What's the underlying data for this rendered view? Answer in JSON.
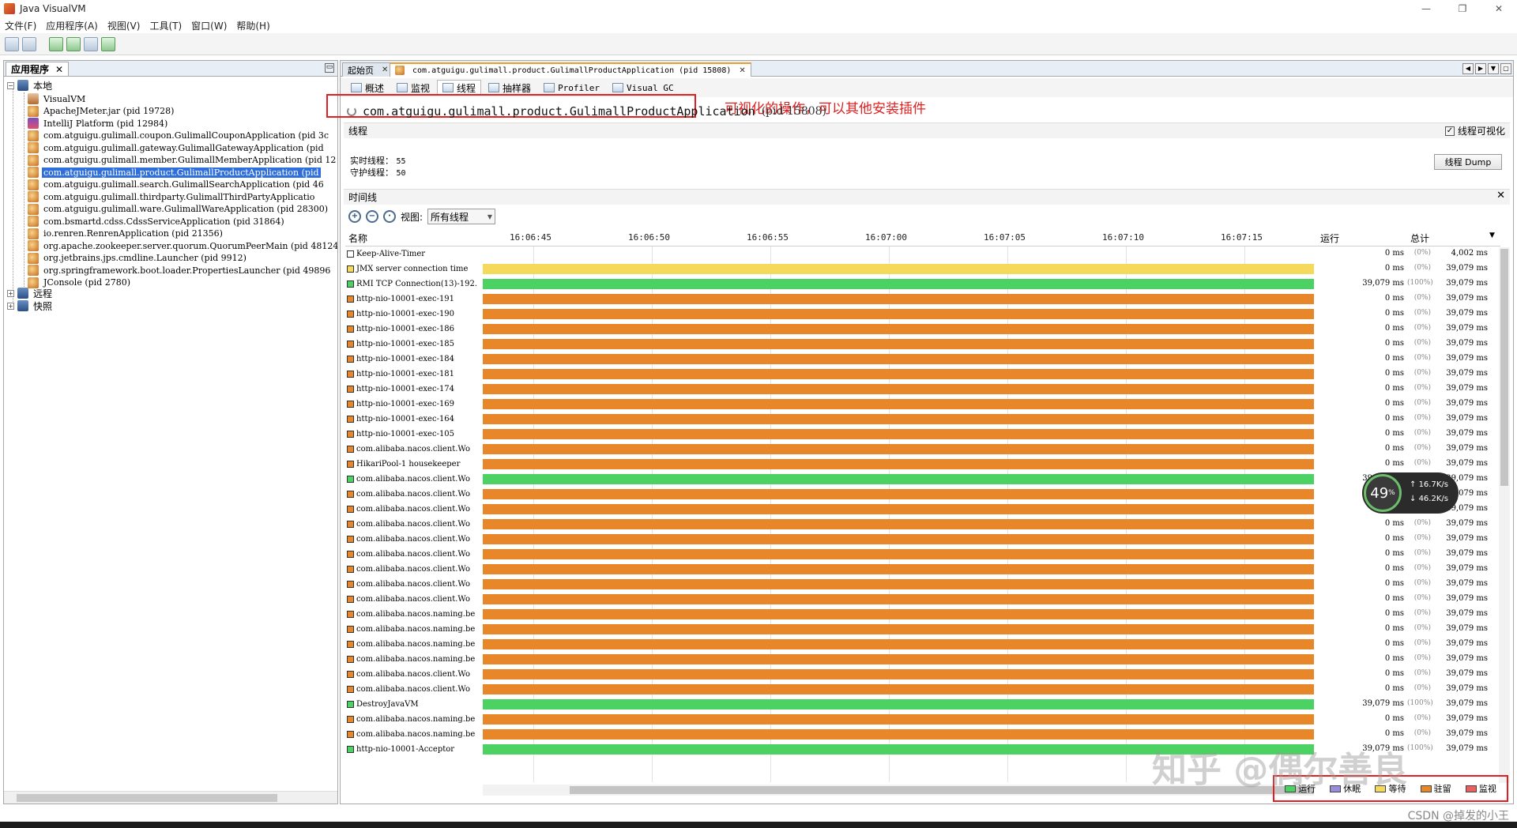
{
  "window": {
    "title": "Java VisualVM"
  },
  "menu": [
    "文件(F)",
    "应用程序(A)",
    "视图(V)",
    "工具(T)",
    "窗口(W)",
    "帮助(H)"
  ],
  "left_panel": {
    "tab": "应用程序",
    "tree": {
      "local": "本地",
      "items": [
        {
          "label": "VisualVM",
          "icon": "visualvm-icon"
        },
        {
          "label": "ApacheJMeter.jar (pid 19728)",
          "icon": "java-icon"
        },
        {
          "label": "IntelliJ Platform (pid 12984)",
          "icon": "intellij-icon"
        },
        {
          "label": "com.atguigu.gulimall.coupon.GulimallCouponApplication (pid 3c",
          "icon": "java-icon"
        },
        {
          "label": "com.atguigu.gulimall.gateway.GulimallGatewayApplication (pid",
          "icon": "java-icon"
        },
        {
          "label": "com.atguigu.gulimall.member.GulimallMemberApplication (pid 12",
          "icon": "java-icon"
        },
        {
          "label": "com.atguigu.gulimall.product.GulimallProductApplication (pid",
          "icon": "java-icon",
          "selected": true
        },
        {
          "label": "com.atguigu.gulimall.search.GulimallSearchApplication (pid 46",
          "icon": "java-icon"
        },
        {
          "label": "com.atguigu.gulimall.thirdparty.GulimallThirdPartyApplicatio",
          "icon": "java-icon"
        },
        {
          "label": "com.atguigu.gulimall.ware.GulimallWareApplication (pid 28300)",
          "icon": "java-icon"
        },
        {
          "label": "com.bsmartd.cdss.CdssServiceApplication (pid 31864)",
          "icon": "java-icon"
        },
        {
          "label": "io.renren.RenrenApplication (pid 21356)",
          "icon": "java-icon"
        },
        {
          "label": "org.apache.zookeeper.server.quorum.QuorumPeerMain (pid 48124)",
          "icon": "java-icon"
        },
        {
          "label": "org.jetbrains.jps.cmdline.Launcher (pid 9912)",
          "icon": "java-icon"
        },
        {
          "label": "org.springframework.boot.loader.PropertiesLauncher (pid 49896",
          "icon": "java-icon"
        },
        {
          "label": "JConsole (pid 2780)",
          "icon": "java-icon"
        }
      ],
      "remote": "远程",
      "snapshots": "快照"
    }
  },
  "doc_tabs": [
    {
      "label": "起始页"
    },
    {
      "label": "com.atguigu.gulimall.product.GulimallProductApplication (pid 15808)",
      "active": true
    }
  ],
  "sub_tabs": [
    "概述",
    "监视",
    "线程",
    "抽样器",
    "Profiler",
    "Visual GC"
  ],
  "annotation": "可视化的操作，可以其他安装插件",
  "app": {
    "name": "com.atguigu.gulimall.product.GulimallProductApplication",
    "pid": "(pid 15808)"
  },
  "threads_section": {
    "title": "线程",
    "visualize_label": "线程可视化",
    "live_label": "实时线程：",
    "live_value": "55",
    "daemon_label": "守护线程：",
    "daemon_value": "50",
    "dump_button": "线程 Dump"
  },
  "timeline_section": {
    "title": "时间线",
    "view_label": "视图:",
    "view_value": "所有线程"
  },
  "table": {
    "col_name": "名称",
    "col_running": "运行",
    "col_total": "总计",
    "ticks": [
      "16:06:45",
      "16:06:50",
      "16:06:55",
      "16:07:00",
      "16:07:05",
      "16:07:10",
      "16:07:15"
    ],
    "rows": [
      {
        "name": "Keep-Alive-Timer",
        "state": "none",
        "run": "0 ms",
        "pct": "(0%)",
        "total": "4,002 ms"
      },
      {
        "name": "JMX server connection time",
        "state": "wait",
        "run": "0 ms",
        "pct": "(0%)",
        "total": "39,079 ms"
      },
      {
        "name": "RMI TCP Connection(13)-192.",
        "state": "running",
        "run": "39,079 ms",
        "pct": "(100%)",
        "total": "39,079 ms"
      },
      {
        "name": "http-nio-10001-exec-191",
        "state": "park",
        "run": "0 ms",
        "pct": "(0%)",
        "total": "39,079 ms"
      },
      {
        "name": "http-nio-10001-exec-190",
        "state": "park",
        "run": "0 ms",
        "pct": "(0%)",
        "total": "39,079 ms"
      },
      {
        "name": "http-nio-10001-exec-186",
        "state": "park",
        "run": "0 ms",
        "pct": "(0%)",
        "total": "39,079 ms"
      },
      {
        "name": "http-nio-10001-exec-185",
        "state": "park",
        "run": "0 ms",
        "pct": "(0%)",
        "total": "39,079 ms"
      },
      {
        "name": "http-nio-10001-exec-184",
        "state": "park",
        "run": "0 ms",
        "pct": "(0%)",
        "total": "39,079 ms"
      },
      {
        "name": "http-nio-10001-exec-181",
        "state": "park",
        "run": "0 ms",
        "pct": "(0%)",
        "total": "39,079 ms"
      },
      {
        "name": "http-nio-10001-exec-174",
        "state": "park",
        "run": "0 ms",
        "pct": "(0%)",
        "total": "39,079 ms"
      },
      {
        "name": "http-nio-10001-exec-169",
        "state": "park",
        "run": "0 ms",
        "pct": "(0%)",
        "total": "39,079 ms"
      },
      {
        "name": "http-nio-10001-exec-164",
        "state": "park",
        "run": "0 ms",
        "pct": "(0%)",
        "total": "39,079 ms"
      },
      {
        "name": "http-nio-10001-exec-105",
        "state": "park",
        "run": "0 ms",
        "pct": "(0%)",
        "total": "39,079 ms"
      },
      {
        "name": "com.alibaba.nacos.client.Wo",
        "state": "park",
        "run": "0 ms",
        "pct": "(0%)",
        "total": "39,079 ms"
      },
      {
        "name": "HikariPool-1 housekeeper",
        "state": "park",
        "run": "0 ms",
        "pct": "(0%)",
        "total": "39,079 ms"
      },
      {
        "name": "com.alibaba.nacos.client.Wo",
        "state": "running",
        "run": "39,079 ms",
        "pct": "(100%)",
        "total": "39,079 ms"
      },
      {
        "name": "com.alibaba.nacos.client.Wo",
        "state": "park",
        "run": "0 ms",
        "pct": "(0%)",
        "total": "39,079 ms"
      },
      {
        "name": "com.alibaba.nacos.client.Wo",
        "state": "park",
        "run": "0 ms",
        "pct": "(0%)",
        "total": "39,079 ms"
      },
      {
        "name": "com.alibaba.nacos.client.Wo",
        "state": "park",
        "run": "0 ms",
        "pct": "(0%)",
        "total": "39,079 ms"
      },
      {
        "name": "com.alibaba.nacos.client.Wo",
        "state": "park",
        "run": "0 ms",
        "pct": "(0%)",
        "total": "39,079 ms"
      },
      {
        "name": "com.alibaba.nacos.client.Wo",
        "state": "park",
        "run": "0 ms",
        "pct": "(0%)",
        "total": "39,079 ms"
      },
      {
        "name": "com.alibaba.nacos.client.Wo",
        "state": "park",
        "run": "0 ms",
        "pct": "(0%)",
        "total": "39,079 ms"
      },
      {
        "name": "com.alibaba.nacos.client.Wo",
        "state": "park",
        "run": "0 ms",
        "pct": "(0%)",
        "total": "39,079 ms"
      },
      {
        "name": "com.alibaba.nacos.client.Wo",
        "state": "park",
        "run": "0 ms",
        "pct": "(0%)",
        "total": "39,079 ms"
      },
      {
        "name": "com.alibaba.nacos.naming.be",
        "state": "park",
        "run": "0 ms",
        "pct": "(0%)",
        "total": "39,079 ms"
      },
      {
        "name": "com.alibaba.nacos.naming.be",
        "state": "park",
        "run": "0 ms",
        "pct": "(0%)",
        "total": "39,079 ms"
      },
      {
        "name": "com.alibaba.nacos.naming.be",
        "state": "park",
        "run": "0 ms",
        "pct": "(0%)",
        "total": "39,079 ms"
      },
      {
        "name": "com.alibaba.nacos.naming.be",
        "state": "park",
        "run": "0 ms",
        "pct": "(0%)",
        "total": "39,079 ms"
      },
      {
        "name": "com.alibaba.nacos.client.Wo",
        "state": "park",
        "run": "0 ms",
        "pct": "(0%)",
        "total": "39,079 ms"
      },
      {
        "name": "com.alibaba.nacos.client.Wo",
        "state": "park",
        "run": "0 ms",
        "pct": "(0%)",
        "total": "39,079 ms"
      },
      {
        "name": "DestroyJavaVM",
        "state": "running",
        "run": "39,079 ms",
        "pct": "(100%)",
        "total": "39,079 ms"
      },
      {
        "name": "com.alibaba.nacos.naming.be",
        "state": "park",
        "run": "0 ms",
        "pct": "(0%)",
        "total": "39,079 ms"
      },
      {
        "name": "com.alibaba.nacos.naming.be",
        "state": "park",
        "run": "0 ms",
        "pct": "(0%)",
        "total": "39,079 ms"
      },
      {
        "name": "http-nio-10001-Acceptor",
        "state": "running",
        "run": "39,079 ms",
        "pct": "(100%)",
        "total": "39,079 ms"
      }
    ]
  },
  "legend": [
    {
      "label": "运行",
      "color": "#4bd262"
    },
    {
      "label": "休眠",
      "color": "#9a8cd8"
    },
    {
      "label": "等待",
      "color": "#f5d95a"
    },
    {
      "label": "驻留",
      "color": "#e8862a"
    },
    {
      "label": "监视",
      "color": "#e86060"
    }
  ],
  "state_colors": {
    "running": "#4bd262",
    "wait": "#f5d95a",
    "park": "#e8862a",
    "none": "#ffffff"
  },
  "net_monitor": {
    "cpu": "49",
    "unit": "%",
    "up": "16.7K/s",
    "down": "46.2K/s"
  },
  "watermarks": {
    "zhihu": "知乎 @偶尔善良",
    "csdn": "CSDN @掉发的小王"
  }
}
